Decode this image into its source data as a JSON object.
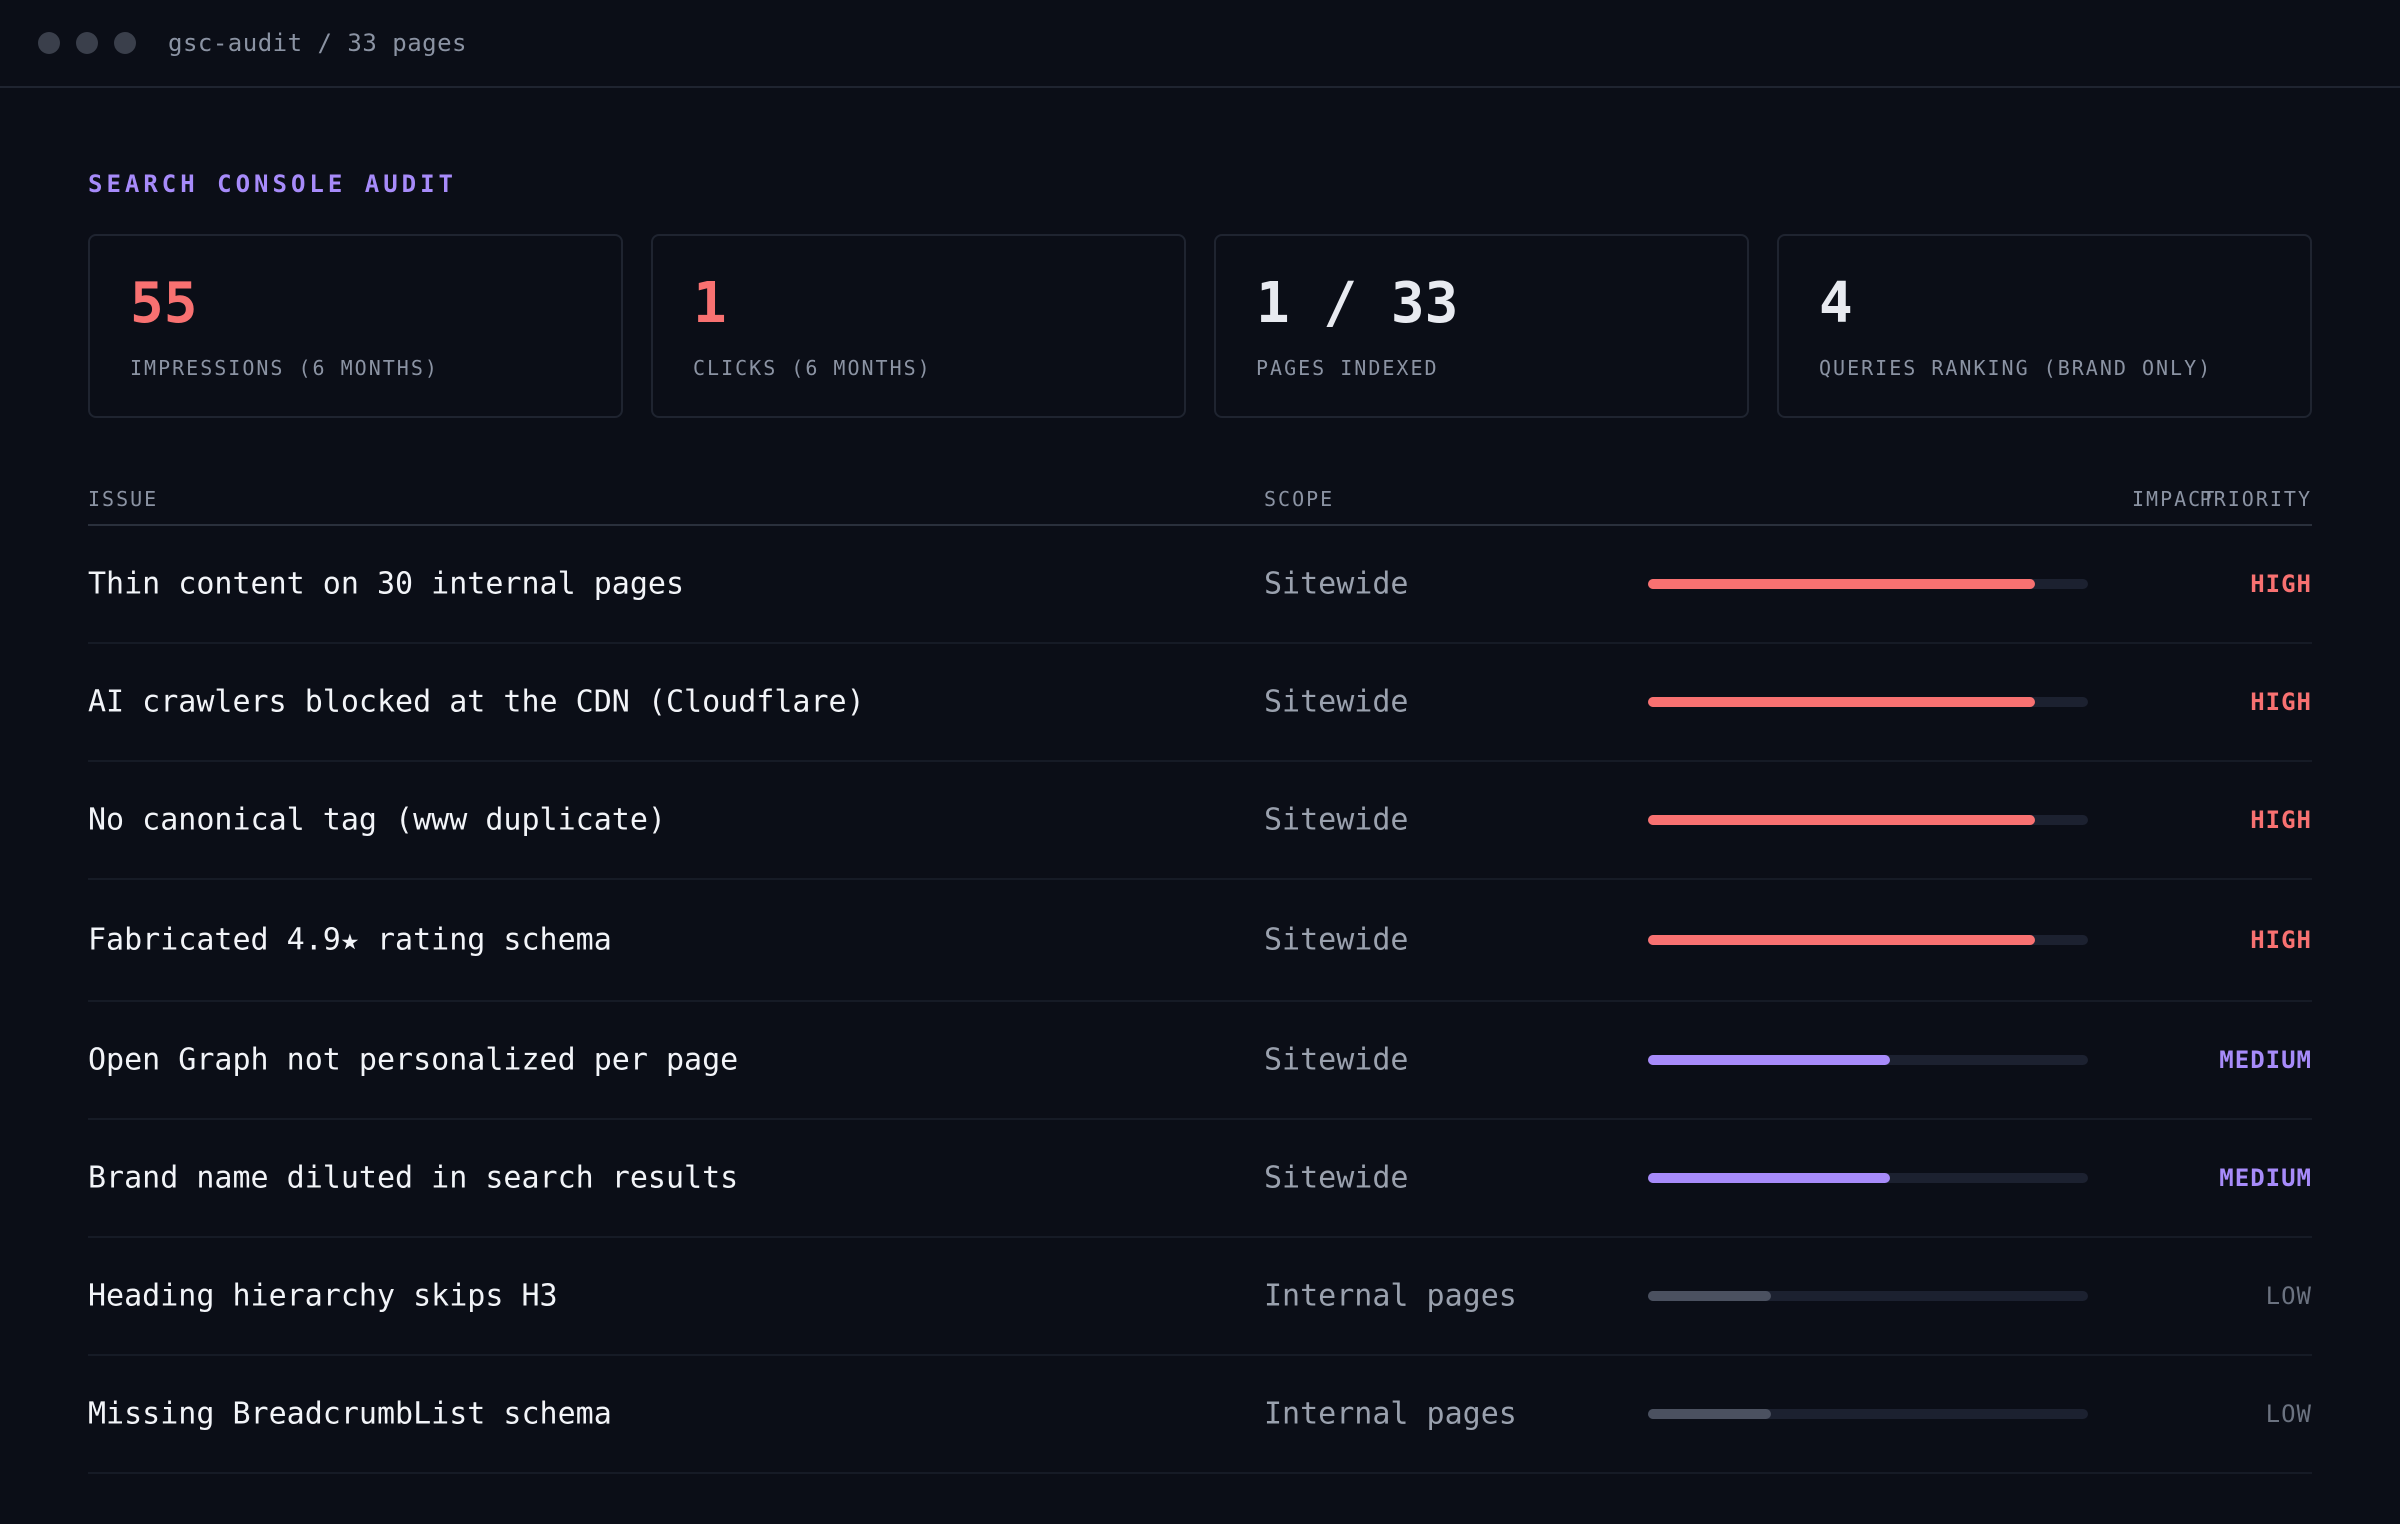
{
  "window": {
    "title": "gsc-audit / 33 pages"
  },
  "heading": "SEARCH CONSOLE AUDIT",
  "stats": [
    {
      "value": "55",
      "label": "IMPRESSIONS (6 MONTHS)",
      "color": "#f87171"
    },
    {
      "value": "1",
      "label": "CLICKS (6 MONTHS)",
      "color": "#f87171"
    },
    {
      "value": "1 / 33",
      "label": "PAGES INDEXED",
      "color": "#e8eaf0"
    },
    {
      "value": "4",
      "label": "QUERIES RANKING (BRAND ONLY)",
      "color": "#e8eaf0"
    }
  ],
  "table": {
    "headers": {
      "issue": "ISSUE",
      "scope": "SCOPE",
      "impact": "IMPACT",
      "priority": "PRIORITY"
    },
    "rows": [
      {
        "issue": "Thin content on 30 internal pages",
        "scope": "Sitewide",
        "impact": 0.88,
        "priority": "HIGH",
        "level": "high"
      },
      {
        "issue": "AI crawlers blocked at the CDN (Cloudflare)",
        "scope": "Sitewide",
        "impact": 0.88,
        "priority": "HIGH",
        "level": "high"
      },
      {
        "issue": "No canonical tag (www duplicate)",
        "scope": "Sitewide",
        "impact": 0.88,
        "priority": "HIGH",
        "level": "high"
      },
      {
        "issue": "Fabricated 4.9★ rating schema",
        "scope": "Sitewide",
        "impact": 0.88,
        "priority": "HIGH",
        "level": "high"
      },
      {
        "issue": "Open Graph not personalized per page",
        "scope": "Sitewide",
        "impact": 0.55,
        "priority": "MEDIUM",
        "level": "medium"
      },
      {
        "issue": "Brand name diluted in search results",
        "scope": "Sitewide",
        "impact": 0.55,
        "priority": "MEDIUM",
        "level": "medium"
      },
      {
        "issue": "Heading hierarchy skips H3",
        "scope": "Internal pages",
        "impact": 0.28,
        "priority": "LOW",
        "level": "low"
      },
      {
        "issue": "Missing BreadcrumbList schema",
        "scope": "Internal pages",
        "impact": 0.28,
        "priority": "LOW",
        "level": "low"
      }
    ]
  },
  "colors": {
    "high": "#f87171",
    "medium": "#a78bfa",
    "low": "#6b7280",
    "accent": "#a78bfa"
  }
}
